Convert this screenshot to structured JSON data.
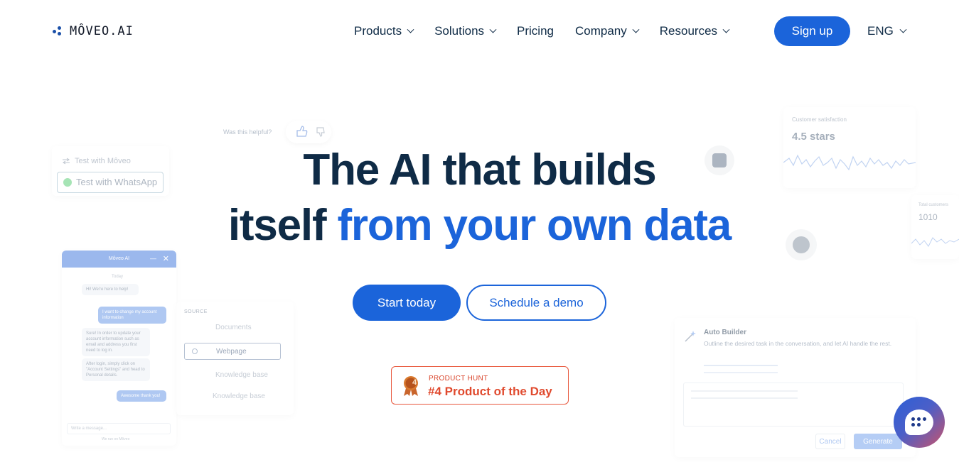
{
  "brand": {
    "name": "MÔVEO.AI",
    "accent": "#1b64da",
    "dark": "#0f2b46"
  },
  "nav": {
    "items": [
      {
        "label": "Products",
        "dropdown": true
      },
      {
        "label": "Solutions",
        "dropdown": true
      },
      {
        "label": "Pricing",
        "dropdown": false
      },
      {
        "label": "Company",
        "dropdown": true
      },
      {
        "label": "Resources",
        "dropdown": true
      }
    ],
    "signup_label": "Sign up",
    "language": "ENG"
  },
  "hero": {
    "line1": "The AI that builds",
    "line2_plain": "itself",
    "line2_accent": "from your own data",
    "start_label": "Start today",
    "demo_label": "Schedule a demo"
  },
  "product_hunt": {
    "rank_badge": "4",
    "small": "PRODUCT HUNT",
    "big": "#4 Product of the Day"
  },
  "decor": {
    "helpful": "Was this helpful?",
    "test_moveo": "Test with Môveo",
    "test_whatsapp": "Test with WhatsApp",
    "chat": {
      "title": "Môveo AI",
      "today": "Today",
      "msg1": "Hi! We're here to help!",
      "msg2": "I want to change my account information",
      "msg3": "Sure! In order to update your account information such as email and address you first need to log in.",
      "msg4": "After login, simply click on \"Account Settings\" and head to Personal details.",
      "msg5": "Awesome thank you!",
      "placeholder": "Write a message...",
      "powered": "We run on Môveo"
    },
    "source": {
      "label": "SOURCE",
      "rows": [
        "Documents",
        "Webpage",
        "Knowledge base",
        "Knowledge base"
      ]
    },
    "satisfaction": {
      "label": "Customer satisfaction",
      "value": "4.5 stars"
    },
    "total": {
      "label": "Total customers",
      "value": "1010"
    },
    "auto_builder": {
      "title": "Auto Builder",
      "desc": "Outline the desired task in the conversation, and let AI handle the rest.",
      "cancel": "Cancel",
      "generate": "Generate"
    }
  }
}
